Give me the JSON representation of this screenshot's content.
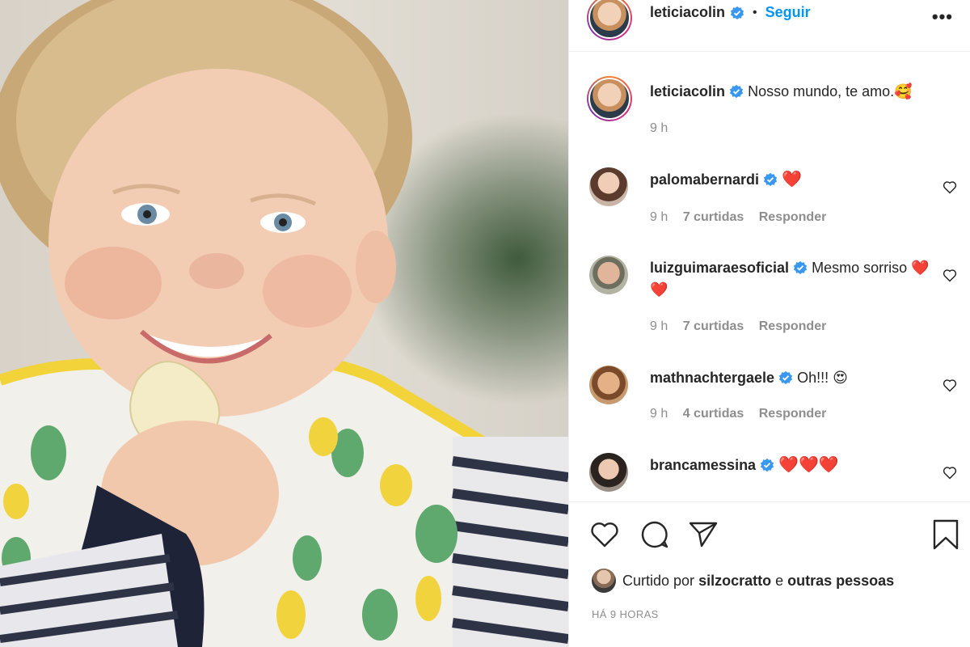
{
  "post": {
    "username": "leticiacolin",
    "follow_label": "Seguir",
    "more_label": "•••",
    "separator": "•"
  },
  "caption": {
    "username": "leticiacolin",
    "text": "Nosso mundo, te amo.",
    "emoji": "🥰",
    "time": "9 h"
  },
  "comments": [
    {
      "username": "palomabernardi",
      "text": "❤️",
      "time": "9 h",
      "likes": "7 curtidas",
      "reply": "Responder"
    },
    {
      "username": "luizguimaraesoficial",
      "text": "Mesmo sorriso ❤️❤️",
      "time": "9 h",
      "likes": "7 curtidas",
      "reply": "Responder"
    },
    {
      "username": "mathnachtergaele",
      "text": "Oh!!! 😍",
      "time": "9 h",
      "likes": "4 curtidas",
      "reply": "Responder"
    },
    {
      "username": "brancamessina",
      "text": "❤️❤️❤️"
    }
  ],
  "likes": {
    "prefix": "Curtido por",
    "user": "silzocratto",
    "joiner": "e",
    "others": "outras pessoas"
  },
  "timestamp": "HÁ 9 HORAS",
  "colors": {
    "accent": "#0095f6",
    "verified": "#3897f0",
    "meta": "#8e8e8e"
  }
}
